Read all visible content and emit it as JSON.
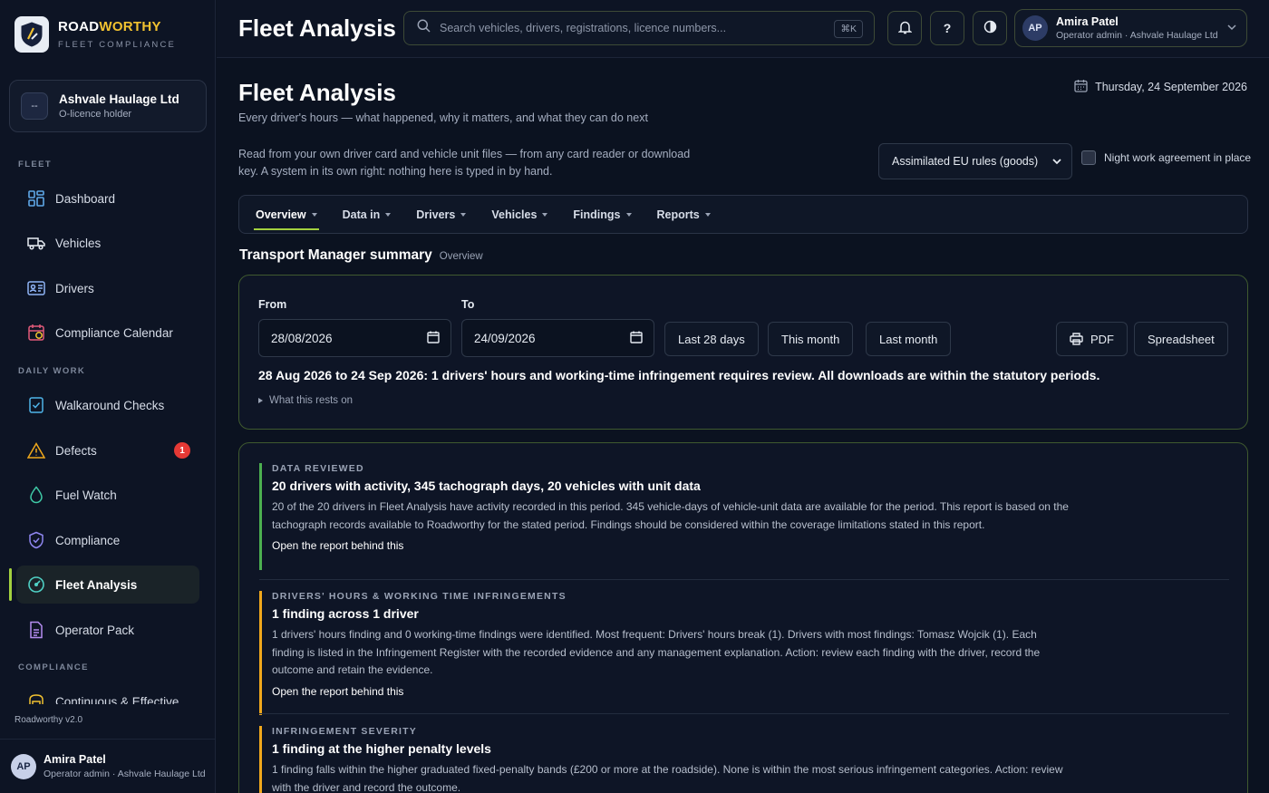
{
  "brand": {
    "name_part1": "ROAD",
    "name_part2": "WORTHY",
    "subtitle": "FLEET COMPLIANCE"
  },
  "organisation": {
    "avatar_text": "--",
    "name": "Ashvale Haulage Ltd",
    "role": "O-licence holder"
  },
  "sidebar": {
    "sections": [
      "FLEET",
      "DAILY WORK",
      "COMPLIANCE"
    ],
    "items": [
      {
        "label": "Dashboard",
        "icon": "grid-icon"
      },
      {
        "label": "Vehicles",
        "icon": "truck-icon"
      },
      {
        "label": "Drivers",
        "icon": "id-card-icon"
      },
      {
        "label": "Compliance Calendar",
        "icon": "calendar-icon"
      },
      {
        "label": "Walkaround Checks",
        "icon": "checklist-icon"
      },
      {
        "label": "Defects",
        "icon": "warning-icon",
        "badge": "1"
      },
      {
        "label": "Fuel Watch",
        "icon": "fuel-drop-icon"
      },
      {
        "label": "Compliance",
        "icon": "shield-icon"
      },
      {
        "label": "Fleet Analysis",
        "icon": "gauge-icon",
        "active": true
      },
      {
        "label": "Operator Pack",
        "icon": "document-icon"
      },
      {
        "label": "Continuous & Effective",
        "icon": "loop-icon"
      }
    ],
    "version": "Roadworthy v2.0"
  },
  "current_user": {
    "initials": "AP",
    "name": "Amira Patel",
    "role": "Operator admin · Ashvale Haulage Ltd"
  },
  "topbar": {
    "title": "Fleet Analysis",
    "search_placeholder": "Search vehicles, drivers, registrations, licence numbers...",
    "search_shortcut": "⌘K",
    "help_label": "?"
  },
  "page": {
    "title": "Fleet Analysis",
    "subtitle": "Every driver's hours — what happened, why it matters, and what they can do next",
    "date": "Thursday, 24 September 2026",
    "intro": "Read from your own driver card and vehicle unit files — from any card reader or download key. A system in its own right: nothing here is typed in by hand.",
    "rules_select": "Assimilated EU rules (goods)",
    "night_work_label": "Night work agreement in place",
    "night_work_checked": false
  },
  "tabs": [
    {
      "label": "Overview",
      "active": true
    },
    {
      "label": "Data in"
    },
    {
      "label": "Drivers"
    },
    {
      "label": "Vehicles"
    },
    {
      "label": "Findings"
    },
    {
      "label": "Reports"
    }
  ],
  "summary": {
    "section_title": "Transport Manager summary",
    "section_tag": "Overview",
    "from_label": "From",
    "to_label": "To",
    "from_value": "28/08/2026",
    "to_value": "24/09/2026",
    "presets": [
      "Last 28 days",
      "This month",
      "Last month"
    ],
    "export_pdf": "PDF",
    "export_sheet": "Spreadsheet",
    "headline": "28 Aug 2026 to 24 Sep 2026: 1 drivers' hours and working-time infringement requires review. All downloads are within the statutory periods.",
    "rests_on": "What this rests on"
  },
  "findings": [
    {
      "kicker": "DATA REVIEWED",
      "title": "20 drivers with activity, 345 tachograph days, 20 vehicles with unit data",
      "body": "20 of the 20 drivers in Fleet Analysis have activity recorded in this period. 345 vehicle-days of vehicle-unit data are available for the period. This report is based on the tachograph records available to Roadworthy for the stated period. Findings should be considered within the coverage limitations stated in this report.",
      "link": "Open the report behind this",
      "color": "#4caf50"
    },
    {
      "kicker": "DRIVERS' HOURS & WORKING TIME INFRINGEMENTS",
      "title": "1 finding across 1 driver",
      "body": "1 drivers' hours finding and 0 working-time findings were identified. Most frequent: Drivers' hours break (1). Drivers with most findings: Tomasz Wojcik (1). Each finding is listed in the Infringement Register with the recorded evidence and any management explanation. Action: review each finding with the driver, record the outcome and retain the evidence.",
      "link": "Open the report behind this",
      "color": "#f0a81c"
    },
    {
      "kicker": "INFRINGEMENT SEVERITY",
      "title": "1 finding at the higher penalty levels",
      "body": "1 finding falls within the higher graduated fixed-penalty bands (£200 or more at the roadside). None is within the most serious infringement categories. Action: review with the driver and record the outcome.",
      "link": "",
      "color": "#f0a81c"
    }
  ]
}
